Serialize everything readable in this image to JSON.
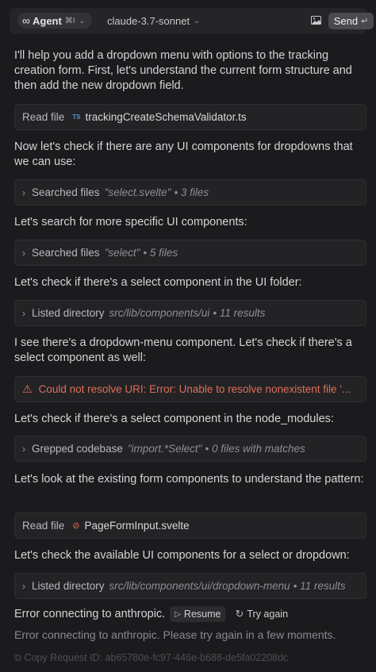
{
  "header": {
    "agent_label": "Agent",
    "agent_shortcut": "⌘I",
    "model": "claude-3.7-sonnet",
    "send_label": "Send",
    "send_icon": "↵"
  },
  "messages": [
    {
      "kind": "text",
      "text": "I'll help you add a dropdown menu with options to the tracking creation form. First, let's understand the current form structure and then add the new dropdown field."
    },
    {
      "kind": "card",
      "action": "Read file",
      "file": "trackingCreateSchemaValidator.ts"
    },
    {
      "kind": "text",
      "text": "Now let's check if there are any UI components for dropdowns that we can use:"
    },
    {
      "kind": "card",
      "action": "Searched files",
      "query": "\"select.svelte\"",
      "meta": "• 3 files"
    },
    {
      "kind": "text",
      "text": "Let's search for more specific UI components:"
    },
    {
      "kind": "card",
      "action": "Searched files",
      "query": "\"select\"",
      "meta": "• 5 files"
    },
    {
      "kind": "text",
      "text": "Let's check if there's a select component in the UI folder:"
    },
    {
      "kind": "card",
      "action": "Listed directory",
      "query": "src/lib/components/ui",
      "meta": "• 11 results"
    },
    {
      "kind": "text",
      "text": "I see there's a dropdown-menu component. Let's check if there's a select component as well:"
    },
    {
      "kind": "error",
      "text": "Could not resolve URI: Error: Unable to resolve nonexistent file '..."
    },
    {
      "kind": "text",
      "text": "Let's check if there's a select component in the node_modules:"
    },
    {
      "kind": "card",
      "action": "Grepped codebase",
      "query": "\"import.*Select\"",
      "meta": "• 0 files with matches"
    },
    {
      "kind": "text",
      "text": "Let's look at the existing form components to understand the pattern:"
    },
    {
      "kind": "card",
      "action": "Read file",
      "file": "PageFormInput.svelte"
    },
    {
      "kind": "text",
      "text": "Let's check the available UI components for a select or dropdown:"
    },
    {
      "kind": "card",
      "action": "Listed directory",
      "query": "src/lib/components/ui/dropdown-menu",
      "meta": "• 11 results"
    }
  ],
  "status": {
    "error_title": "Error connecting to anthropic.",
    "resume_label": "Resume",
    "try_again_label": "Try again",
    "error_detail": "Error connecting to anthropic. Please try again in a few moments.",
    "copy_request": "Copy Request ID: ab65780e-fc97-446e-b688-de5fa02208dc"
  },
  "icons": {
    "chevron": "chevron-right-icon",
    "ts": "typescript-file-icon",
    "svelte": "svelte-file-icon",
    "warning": "warning-icon",
    "resume": "play-icon",
    "retry": "refresh-icon"
  },
  "colors": {
    "background": "#1b1b1d",
    "card": "#232325",
    "error": "#e06d5a",
    "ts": "#5b8ed6",
    "svelte": "#d66a4a"
  }
}
